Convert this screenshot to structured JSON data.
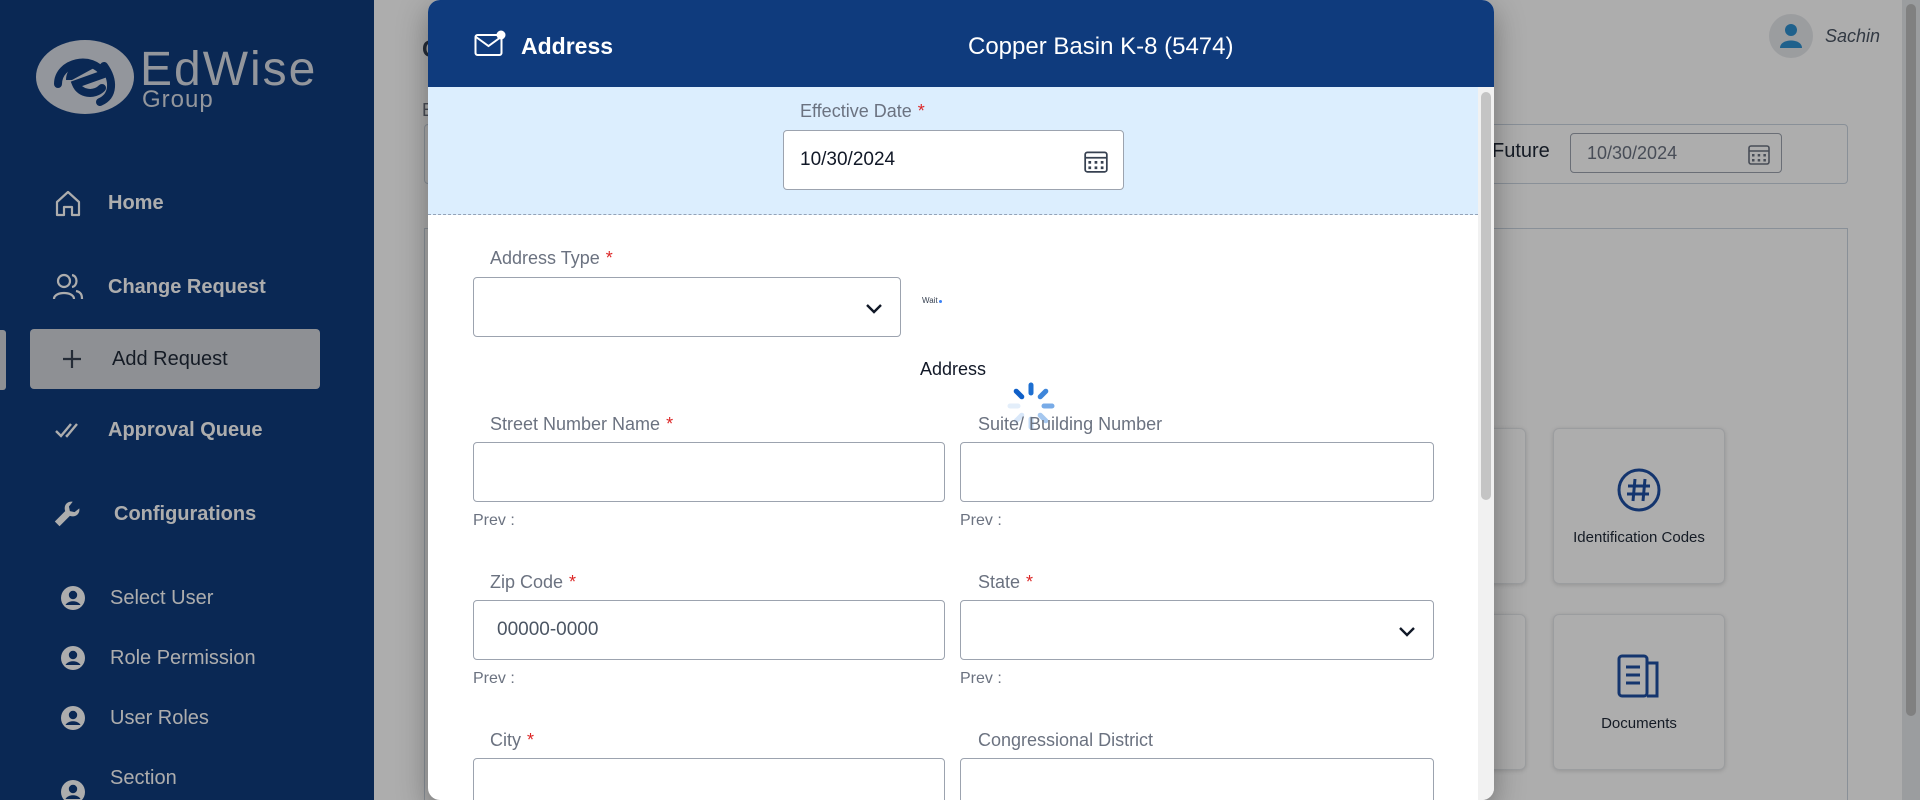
{
  "brand": {
    "name": "EdWise",
    "sub": "Group"
  },
  "sidebar": {
    "items": [
      {
        "label": "Home",
        "icon": "home-icon"
      },
      {
        "label": "Change Request",
        "icon": "users-icon"
      },
      {
        "label": "Add Request",
        "icon": "plus-icon"
      },
      {
        "label": "Approval Queue",
        "icon": "double-check-icon"
      },
      {
        "label": "Configurations",
        "icon": "wrench-icon"
      }
    ],
    "sub_items": [
      {
        "label": "Select User",
        "icon": "user-circle-icon"
      },
      {
        "label": "Role Permission",
        "icon": "user-circle-icon"
      },
      {
        "label": "User Roles",
        "icon": "user-circle-icon"
      },
      {
        "label": "Section",
        "icon": "user-circle-icon"
      }
    ]
  },
  "header": {
    "user_name": "Sachin"
  },
  "main": {
    "partial_title": "C",
    "partial_label": "E",
    "future_label": "Future",
    "future_date": "10/30/2024",
    "tiles": [
      {
        "label": "Identification Codes",
        "icon": "hash-icon"
      },
      {
        "label": "Documents",
        "icon": "document-icon"
      }
    ]
  },
  "modal": {
    "title": "Address",
    "school": "Copper Basin K-8 (5474)",
    "effective_date": {
      "label": "Effective Date",
      "value": "10/30/2024",
      "required": "*"
    },
    "address_type": {
      "label": "Address Type",
      "value": "",
      "required": "*"
    },
    "wait_text": "Wait",
    "section_title": "Address",
    "street": {
      "label": "Street Number Name",
      "value": "",
      "prev": "Prev :",
      "required": "*"
    },
    "suite": {
      "label": "Suite/ Building Number",
      "value": "",
      "prev": "Prev :"
    },
    "zip": {
      "label": "Zip Code",
      "placeholder": "00000-0000",
      "prev": "Prev :",
      "required": "*"
    },
    "state": {
      "label": "State",
      "value": "",
      "prev": "Prev :",
      "required": "*"
    },
    "city": {
      "label": "City",
      "value": "",
      "required": "*"
    },
    "congressional": {
      "label": "Congressional District",
      "value": ""
    }
  },
  "colors": {
    "navy": "#0f3b7d",
    "effective_bg": "#dceefe",
    "required": "#dc2626",
    "accent_icon": "#1e4fa3"
  }
}
